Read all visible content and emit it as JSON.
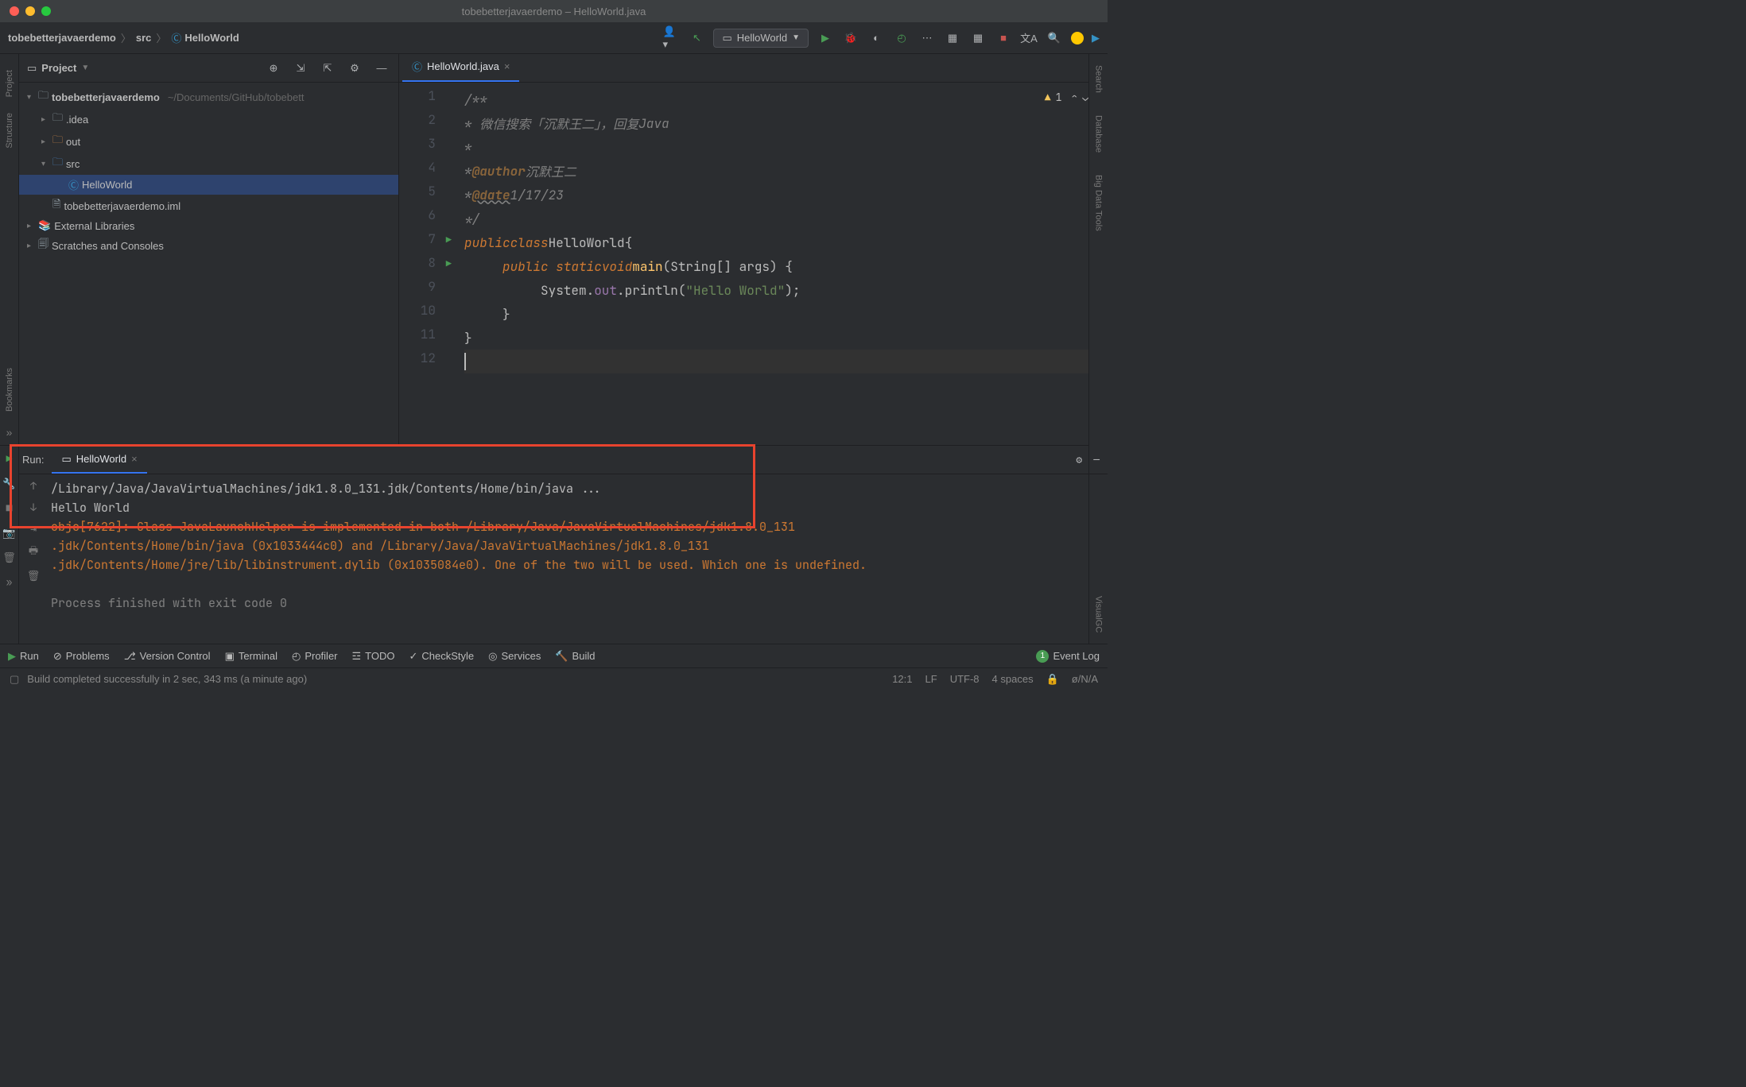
{
  "window": {
    "title": "tobebetterjavaerdemo – HelloWorld.java"
  },
  "breadcrumb": {
    "root": "tobebetterjavaerdemo",
    "folder": "src",
    "file": "HelloWorld"
  },
  "runConfig": {
    "name": "HelloWorld"
  },
  "projectPanel": {
    "title": "Project",
    "tree": {
      "root": "tobebetterjavaerdemo",
      "rootPath": "~/Documents/GitHub/tobebett",
      "idea": ".idea",
      "out": "out",
      "src": "src",
      "helloWorld": "HelloWorld",
      "iml": "tobebetterjavaerdemo.iml",
      "external": "External Libraries",
      "scratches": "Scratches and Consoles"
    }
  },
  "leftRail": {
    "project": "Project",
    "structure": "Structure",
    "bookmarks": "Bookmarks"
  },
  "rightRail": {
    "search": "Search",
    "database": "Database",
    "bigdata": "Big Data Tools",
    "visualgc": "VisualGC"
  },
  "editor": {
    "tabName": "HelloWorld.java",
    "warnCount": "1",
    "lines": {
      "l1": "/**",
      "l2a": " * 微信搜索「沉默王二」，回复 ",
      "l2b": "Java",
      "l3": " *",
      "l4a": " * ",
      "l4tag": "@author",
      "l4b": " 沉默王二",
      "l5a": " * ",
      "l5tag": "@date",
      "l5b": " 1/17/23",
      "l6": " */",
      "l7a": "public",
      "l7b": " class ",
      "l7c": "HelloWorld",
      "l7d": " {",
      "l8a": "public static ",
      "l8b": "void ",
      "l8c": "main",
      "l8d": "(String[] args) {",
      "l9a": "System.",
      "l9b": "out",
      "l9c": ".println(",
      "l9d": "\"Hello World\"",
      "l9e": ");",
      "l10": "}",
      "l11": "}"
    }
  },
  "runPanel": {
    "label": "Run:",
    "tabName": "HelloWorld",
    "output": {
      "line1": "/Library/Java/JavaVirtualMachines/jdk1.8.0_131.jdk/Contents/Home/bin/java ...",
      "line2": "Hello World",
      "warn1": "objc[7622]: Class JavaLaunchHelper is implemented in both /Library/Java/JavaVirtualMachines/jdk1.8.0_131",
      "warn2": ".jdk/Contents/Home/bin/java (0x1033444c0) and /Library/Java/JavaVirtualMachines/jdk1.8.0_131",
      "warn3": ".jdk/Contents/Home/jre/lib/libinstrument.dylib (0x1035084e0). One of the two will be used. Which one is undefined.",
      "exit": "Process finished with exit code 0"
    }
  },
  "bottomBar": {
    "run": "Run",
    "problems": "Problems",
    "vcs": "Version Control",
    "terminal": "Terminal",
    "profiler": "Profiler",
    "todo": "TODO",
    "checkstyle": "CheckStyle",
    "services": "Services",
    "build": "Build",
    "eventLog": "Event Log",
    "eventBadge": "1"
  },
  "statusBar": {
    "message": "Build completed successfully in 2 sec, 343 ms (a minute ago)",
    "pos": "12:1",
    "lineSep": "LF",
    "encoding": "UTF-8",
    "indent": "4 spaces",
    "mem": "ø/N/A"
  }
}
